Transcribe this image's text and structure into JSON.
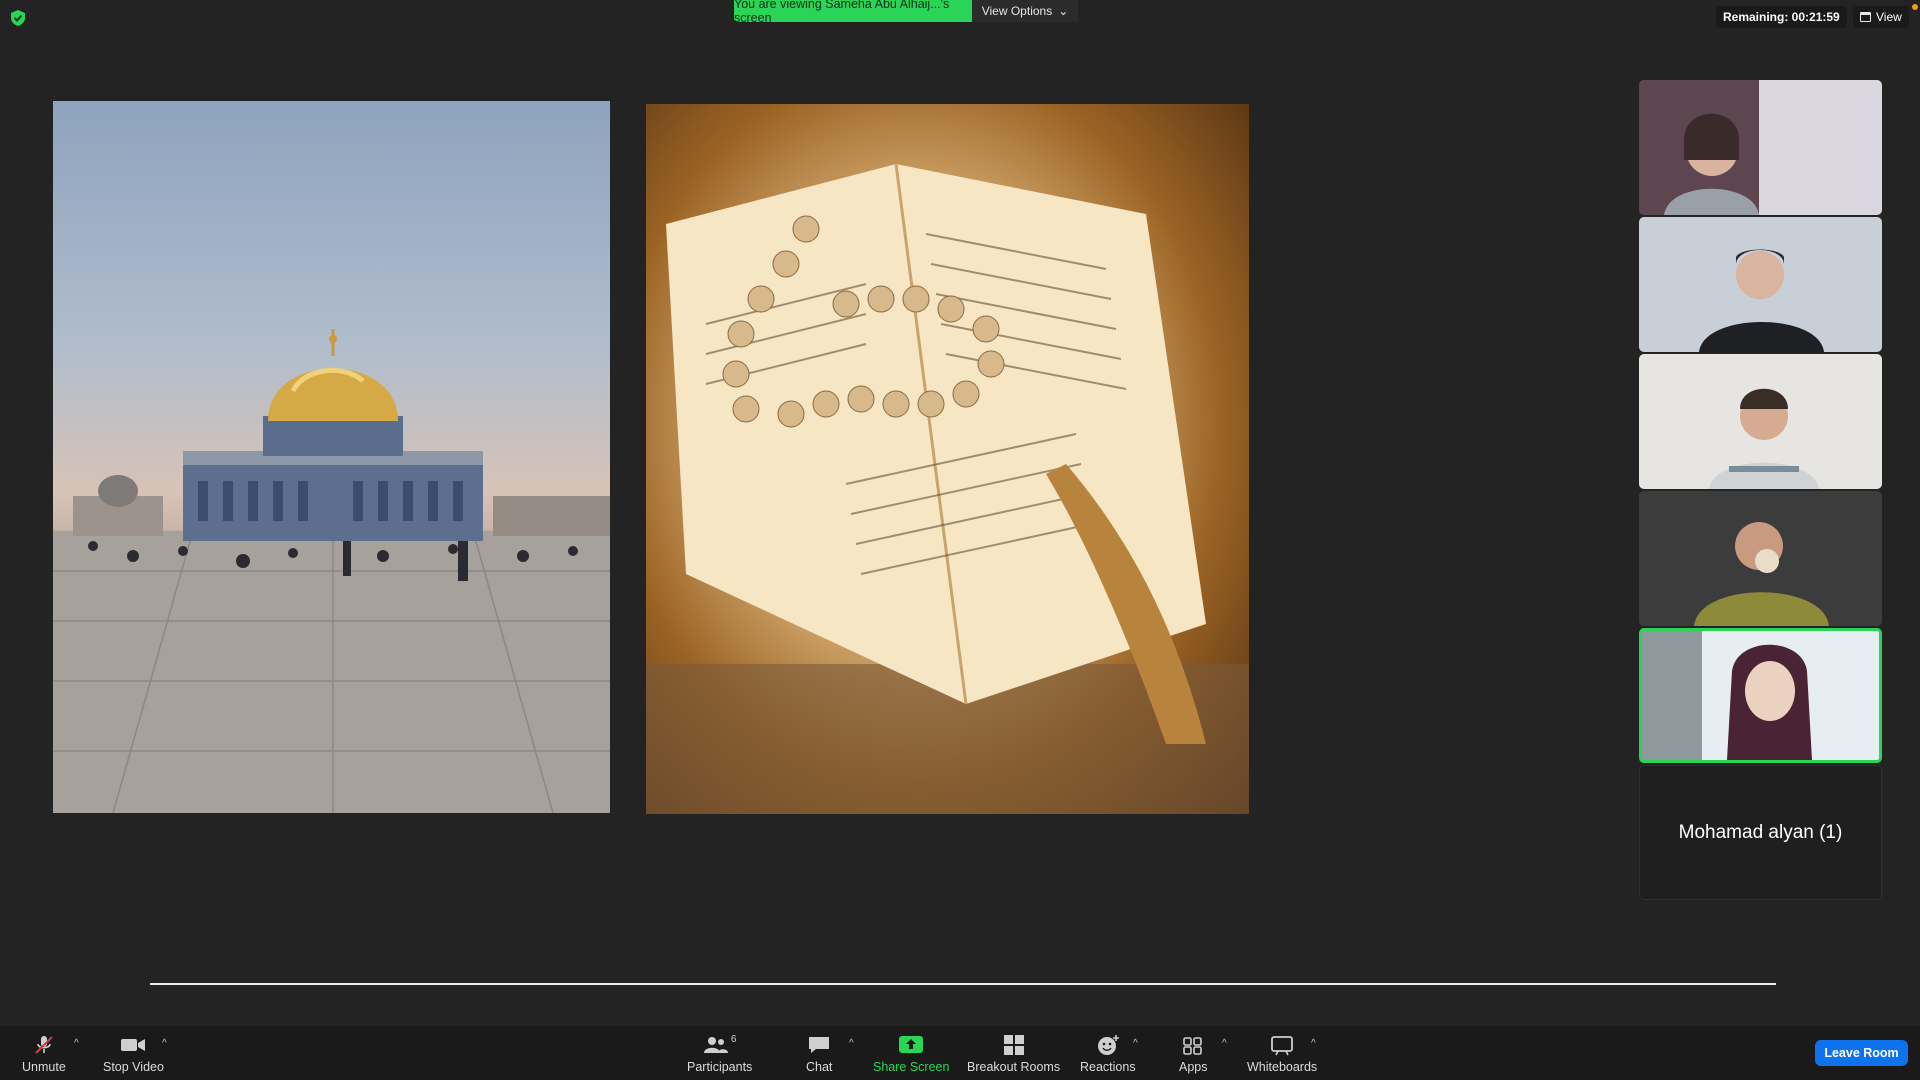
{
  "banner": {
    "viewing_text": "You are viewing Sameha Abu Alhaij...'s screen",
    "view_options_label": "View Options"
  },
  "top_right": {
    "remaining_label": "Remaining: 00:21:59",
    "view_label": "View"
  },
  "gallery": {
    "name_tile_label": "Mohamad alyan (1)"
  },
  "toolbar": {
    "unmute_label": "Unmute",
    "stop_video_label": "Stop Video",
    "participants_label": "Participants",
    "participants_count": "6",
    "chat_label": "Chat",
    "share_screen_label": "Share Screen",
    "breakout_rooms_label": "Breakout Rooms",
    "reactions_label": "Reactions",
    "apps_label": "Apps",
    "whiteboards_label": "Whiteboards",
    "leave_room_label": "Leave Room"
  },
  "colors": {
    "accent_green": "#2ad457",
    "leave_blue": "#0e72ed",
    "background": "#232323"
  }
}
